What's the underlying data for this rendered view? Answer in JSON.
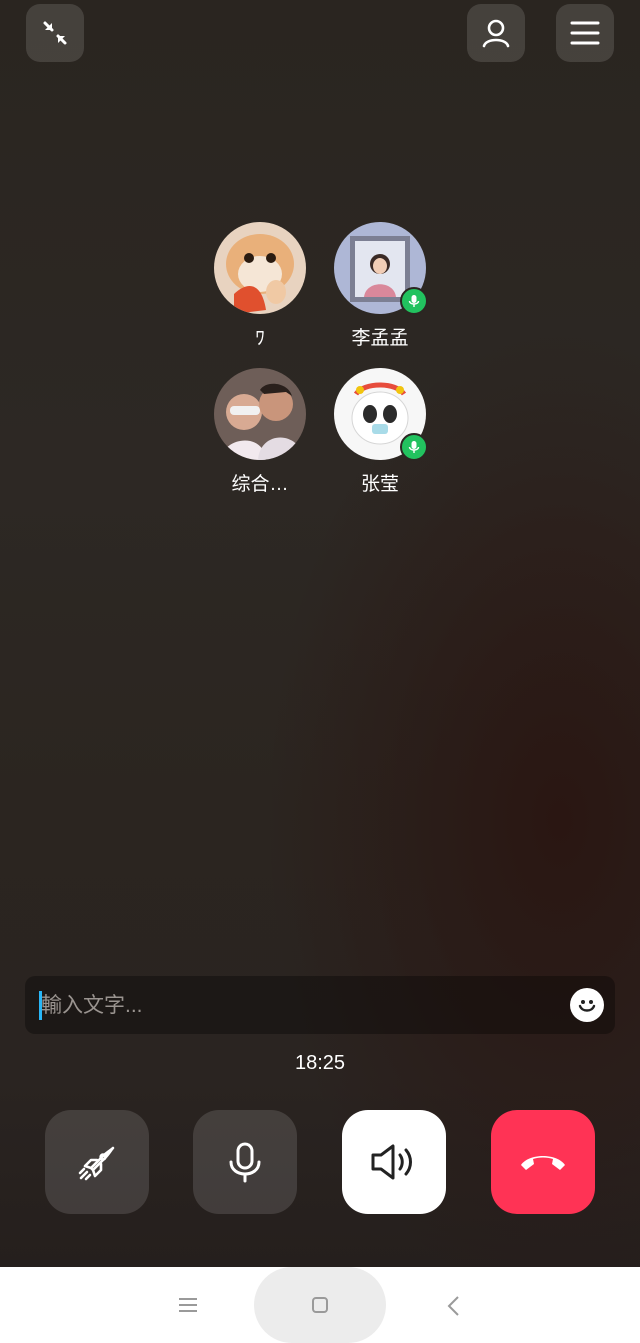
{
  "participants": [
    {
      "name": "ﾜ",
      "speaking": false
    },
    {
      "name": "李孟孟",
      "speaking": true
    },
    {
      "name": "综合…",
      "speaking": false
    },
    {
      "name": "张莹",
      "speaking": true
    }
  ],
  "input": {
    "placeholder": "輸入文字..."
  },
  "call": {
    "duration": "18:25"
  },
  "icons": {
    "minimize": "minimize-icon",
    "contacts": "person-icon",
    "menu": "menu-icon",
    "effects": "rocket-icon",
    "microphone": "microphone-icon",
    "speaker": "speaker-icon",
    "hangup": "hang-up-icon",
    "emoji": "emoji-icon"
  },
  "colors": {
    "hangup": "#ff3355",
    "speaking_badge": "#22c25f",
    "cursor": "#29b6f6"
  }
}
